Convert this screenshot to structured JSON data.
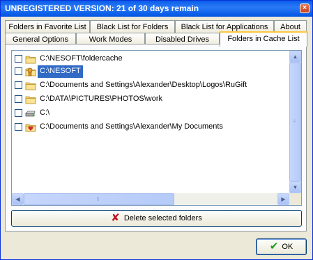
{
  "window": {
    "title": "UNREGISTERED VERSION: 21 of 30 days remain",
    "close_glyph": "×"
  },
  "tabs_row1": [
    {
      "label": "Folders in Favorite List"
    },
    {
      "label": "Black List for Folders"
    },
    {
      "label": "Black List for Applications"
    },
    {
      "label": "About"
    }
  ],
  "tabs_row2": [
    {
      "label": "General Options"
    },
    {
      "label": "Work Modes"
    },
    {
      "label": "Disabled Drives"
    },
    {
      "label": "Folders in Cache List",
      "active": true
    }
  ],
  "folders": [
    {
      "path": "C:\\NESOFT\\foldercache",
      "icon": "folder-icon",
      "checked": false,
      "selected": false
    },
    {
      "path": "C:\\NESOFT",
      "icon": "special-folder-icon",
      "checked": false,
      "selected": true
    },
    {
      "path": "C:\\Documents and Settings\\Alexander\\Desktop\\Logos\\RuGift",
      "icon": "folder-icon",
      "checked": false,
      "selected": false
    },
    {
      "path": "C:\\DATA\\PICTURES\\PHOTOS\\work",
      "icon": "folder-icon",
      "checked": false,
      "selected": false
    },
    {
      "path": "C:\\",
      "icon": "drive-icon",
      "checked": false,
      "selected": false
    },
    {
      "path": "C:\\Documents and Settings\\Alexander\\My Documents",
      "icon": "my-documents-icon",
      "checked": false,
      "selected": false
    }
  ],
  "buttons": {
    "delete_label": "Delete selected folders",
    "ok_label": "OK"
  },
  "colors": {
    "selection": "#316ac5",
    "title_bar": "#0054e3",
    "active_tab_accent": "#ffc83c"
  }
}
